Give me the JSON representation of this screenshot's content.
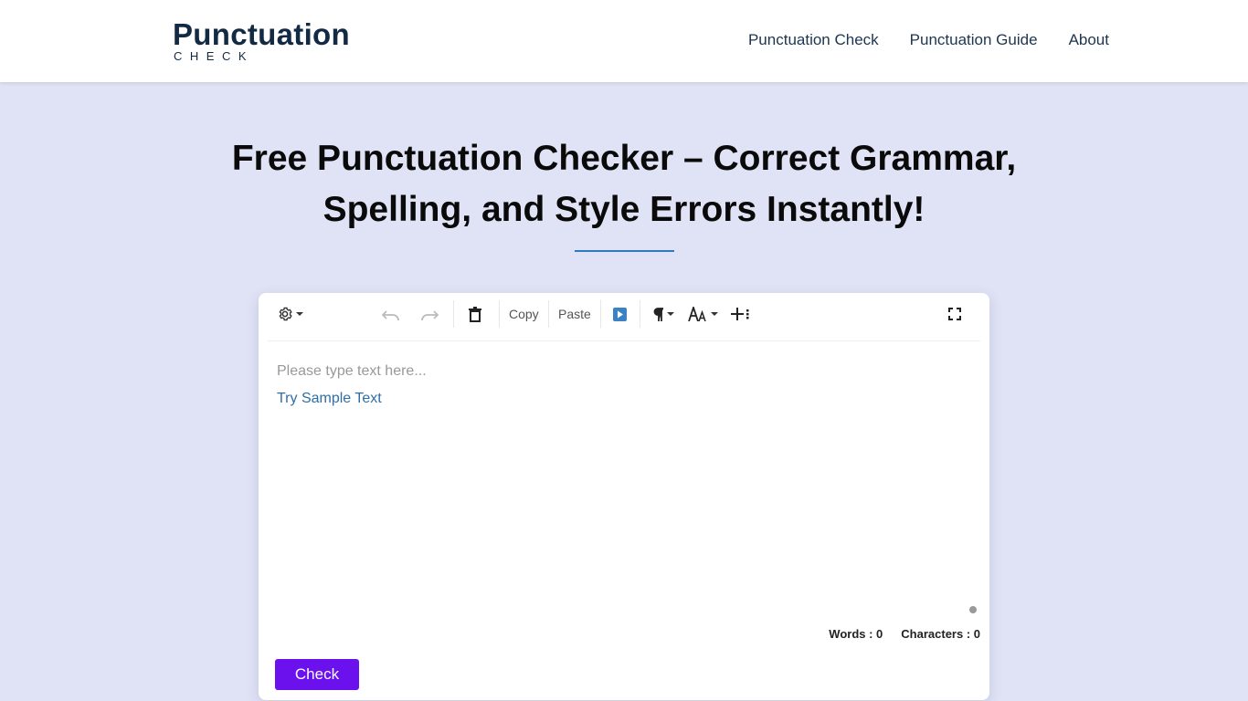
{
  "header": {
    "logo_main": "Punctuation",
    "logo_sub": "CHECK",
    "nav": [
      "Punctuation Check",
      "Punctuation Guide",
      "About"
    ]
  },
  "hero": {
    "title_line1": "Free Punctuation Checker – Correct Grammar,",
    "title_line2": "Spelling, and Style Errors Instantly!"
  },
  "toolbar": {
    "copy_label": "Copy",
    "paste_label": "Paste",
    "icons": [
      "gear-icon",
      "undo-icon",
      "redo-icon",
      "trash-icon",
      "play-icon",
      "paragraph-icon",
      "font-size-icon",
      "insert-icon",
      "fullscreen-icon"
    ]
  },
  "editor": {
    "placeholder": "Please type text here...",
    "sample_link": "Try Sample Text"
  },
  "stats": {
    "words_label": "Words : 0",
    "chars_label": "Characters : 0"
  },
  "actions": {
    "check_label": "Check"
  },
  "colors": {
    "page_bg": "#e0e3f5",
    "brand_dark": "#132a44",
    "accent_blue": "#2f7bbf",
    "check_button": "#6a11ee"
  }
}
